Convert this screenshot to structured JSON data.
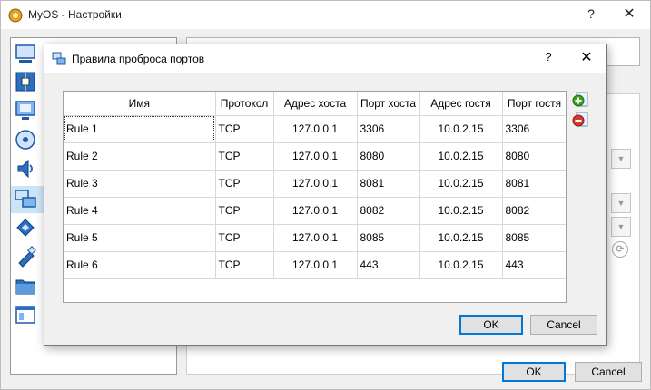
{
  "window": {
    "title": "MyOS - Настройки",
    "help_glyph": "?",
    "close_glyph": "✕",
    "ok_label": "OK",
    "cancel_label": "Cancel"
  },
  "sidebar": {
    "icons": [
      "general-icon",
      "system-icon",
      "display-icon",
      "storage-icon",
      "audio-icon",
      "network-icon",
      "serial-ports-icon",
      "usb-icon",
      "shared-folders-icon",
      "user-interface-icon"
    ]
  },
  "dialog": {
    "title": "Правила проброса портов",
    "help_glyph": "?",
    "close_glyph": "✕",
    "ok_label": "OK",
    "cancel_label": "Cancel",
    "columns": [
      "Имя",
      "Протокол",
      "Адрес хоста",
      "Порт хоста",
      "Адрес гостя",
      "Порт гостя"
    ],
    "rows": [
      {
        "name": "Rule 1",
        "protocol": "TCP",
        "host_ip": "127.0.0.1",
        "host_port": "3306",
        "guest_ip": "10.0.2.15",
        "guest_port": "3306"
      },
      {
        "name": "Rule 2",
        "protocol": "TCP",
        "host_ip": "127.0.0.1",
        "host_port": "8080",
        "guest_ip": "10.0.2.15",
        "guest_port": "8080"
      },
      {
        "name": "Rule 3",
        "protocol": "TCP",
        "host_ip": "127.0.0.1",
        "host_port": "8081",
        "guest_ip": "10.0.2.15",
        "guest_port": "8081"
      },
      {
        "name": "Rule 4",
        "protocol": "TCP",
        "host_ip": "127.0.0.1",
        "host_port": "8082",
        "guest_ip": "10.0.2.15",
        "guest_port": "8082"
      },
      {
        "name": "Rule 5",
        "protocol": "TCP",
        "host_ip": "127.0.0.1",
        "host_port": "8085",
        "guest_ip": "10.0.2.15",
        "guest_port": "8085"
      },
      {
        "name": "Rule 6",
        "protocol": "TCP",
        "host_ip": "127.0.0.1",
        "host_port": "443",
        "guest_ip": "10.0.2.15",
        "guest_port": "443"
      }
    ],
    "tools": [
      "add-rule-icon",
      "remove-rule-icon"
    ]
  },
  "colors": {
    "accent": "#0078d7",
    "add_green": "#3aa31a",
    "remove_red": "#d43a2a"
  }
}
